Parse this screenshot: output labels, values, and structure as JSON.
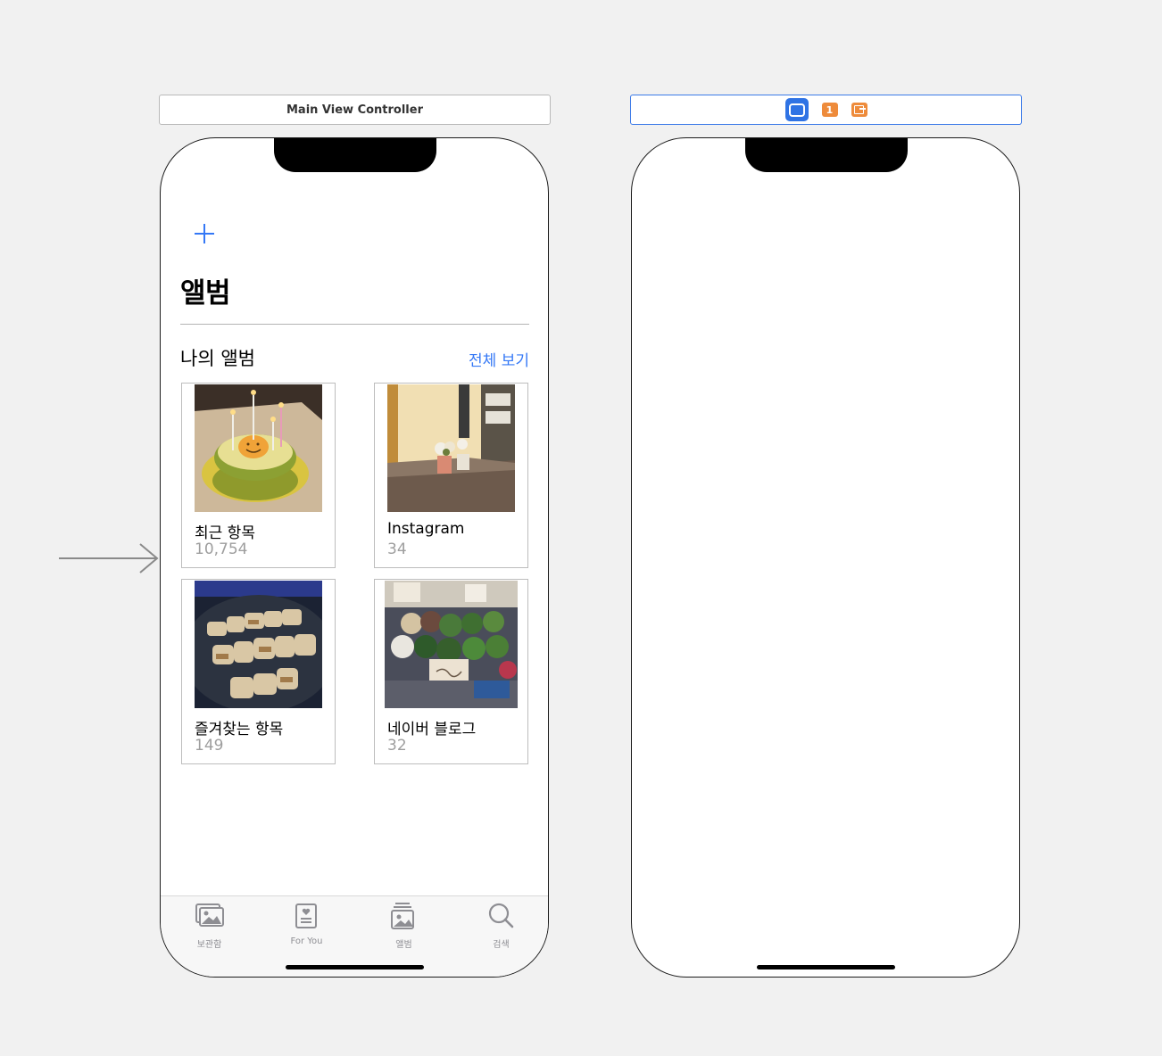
{
  "scenes": {
    "first": {
      "title": "Main View Controller"
    },
    "second": {
      "badge_label": "1"
    }
  },
  "albums_screen": {
    "large_title": "앨범",
    "section_title": "나의 앨범",
    "see_all_label": "전체 보기",
    "albums": [
      {
        "name": "최근 항목",
        "count": "10,754",
        "thumb": "cake-photo"
      },
      {
        "name": "Instagram",
        "count": "34",
        "thumb": "flowerpot-photo"
      },
      {
        "name": "즐겨찾는 항목",
        "count": "149",
        "thumb": "grilled-pork-photo"
      },
      {
        "name": "네이버 블로그",
        "count": "32",
        "thumb": "vegetable-market-photo"
      }
    ]
  },
  "tab_bar": {
    "tabs": [
      {
        "label": "보관함",
        "icon": "photo-library-icon"
      },
      {
        "label": "For You",
        "icon": "for-you-icon"
      },
      {
        "label": "앨범",
        "icon": "albums-icon"
      },
      {
        "label": "검색",
        "icon": "search-icon"
      }
    ]
  }
}
